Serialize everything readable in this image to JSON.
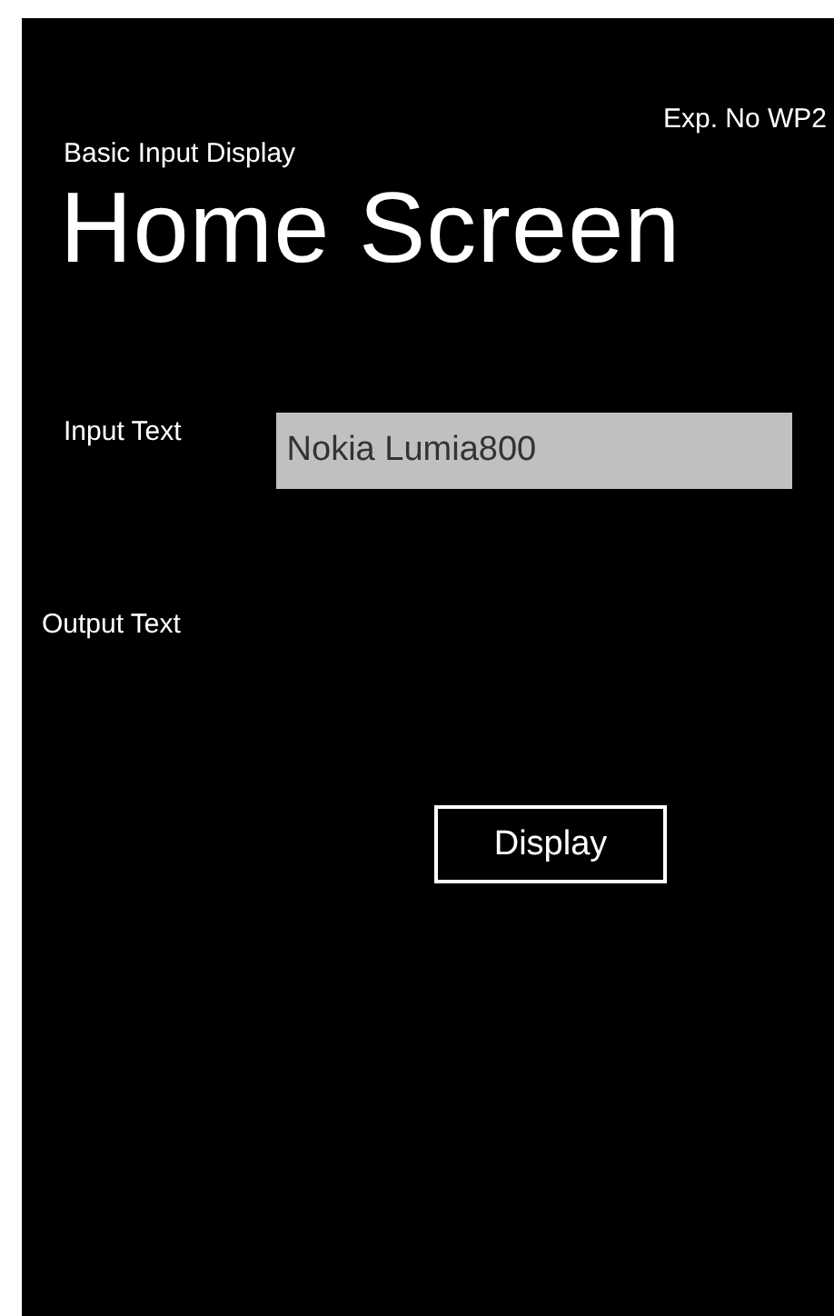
{
  "header": {
    "experiment": "Exp. No WP2",
    "app_title": "Basic Input Display",
    "page_title": "Home Screen"
  },
  "input": {
    "label": "Input Text",
    "value": "Nokia Lumia800"
  },
  "output": {
    "label": "Output Text"
  },
  "button": {
    "label": "Display"
  }
}
